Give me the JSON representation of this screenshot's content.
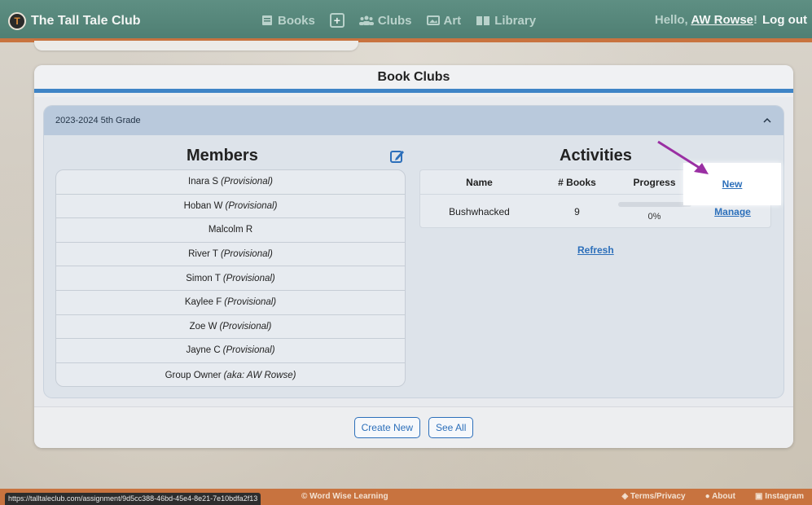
{
  "navbar": {
    "brand": "The Tall Tale Club",
    "books": "Books",
    "clubs": "Clubs",
    "art": "Art",
    "library": "Library",
    "greeting": "Hello,",
    "username": "AW Rowse",
    "exclaim": "!",
    "logout": "Log out"
  },
  "panel": {
    "title": "Book Clubs"
  },
  "club": {
    "name": "2023-2024 5th Grade",
    "members_title": "Members",
    "members": [
      {
        "name": "Inara S",
        "note": "(Provisional)"
      },
      {
        "name": "Hoban W",
        "note": "(Provisional)"
      },
      {
        "name": "Malcolm R",
        "note": ""
      },
      {
        "name": "River T",
        "note": "(Provisional)"
      },
      {
        "name": "Simon T",
        "note": "(Provisional)"
      },
      {
        "name": "Kaylee F",
        "note": "(Provisional)"
      },
      {
        "name": "Zoe W",
        "note": "(Provisional)"
      },
      {
        "name": "Jayne C",
        "note": "(Provisional)"
      },
      {
        "name": "Group Owner",
        "note": "(aka: AW Rowse)"
      }
    ],
    "activities_title": "Activities",
    "activity_headers": {
      "name": "Name",
      "books": "# Books",
      "progress": "Progress",
      "new": "New"
    },
    "activities": [
      {
        "name": "Bushwhacked",
        "books": "9",
        "progress": "0%",
        "progress_value": 0,
        "action": "Manage"
      }
    ],
    "refresh": "Refresh"
  },
  "footer": {
    "create_new": "Create New",
    "see_all": "See All",
    "credit": "© Word Wise Learning",
    "terms": "Terms/Privacy",
    "about": "About",
    "instagram": "Instagram",
    "status_url": "https://talltaleclub.com/assignment/9d5cc388-46bd-45e4-8e21-7e10bdfa2f13"
  },
  "colors": {
    "navbar": "#4f7f73",
    "accent_orange": "#c8733f",
    "accent_blue": "#3f84c6",
    "link": "#2c6fba",
    "arrow": "#9a2fa3"
  }
}
